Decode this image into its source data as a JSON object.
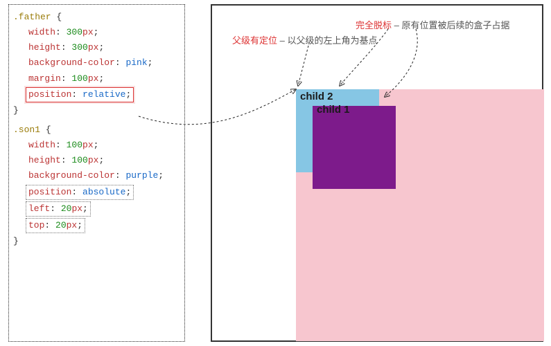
{
  "code": {
    "father": {
      "selector": ".father",
      "open": " {",
      "close": "}",
      "rules": {
        "width": {
          "prop": "width",
          "value": "300",
          "unit": "px",
          "term": ";"
        },
        "height": {
          "prop": "height",
          "value": "300",
          "unit": "px",
          "term": ";"
        },
        "background_color": {
          "prop": "background-color",
          "value": "pink",
          "term": ";"
        },
        "margin": {
          "prop": "margin",
          "value": "100",
          "unit": "px",
          "term": ";"
        },
        "position": {
          "prop": "position",
          "value": "relative",
          "term": ";"
        }
      }
    },
    "son1": {
      "selector": ".son1",
      "open": " {",
      "close": "}",
      "rules": {
        "width": {
          "prop": "width",
          "value": "100",
          "unit": "px",
          "term": ";"
        },
        "height": {
          "prop": "height",
          "value": "100",
          "unit": "px",
          "term": ";"
        },
        "background_color": {
          "prop": "background-color",
          "value": "purple",
          "term": ";"
        },
        "position": {
          "prop": "position",
          "value": "absolute",
          "term": ";"
        },
        "left": {
          "prop": "left",
          "value": "20",
          "unit": "px",
          "term": ";"
        },
        "top": {
          "prop": "top",
          "value": "20",
          "unit": "px",
          "term": ";"
        }
      }
    }
  },
  "labels": {
    "child1": "child 1",
    "child2": "child 2"
  },
  "annotations": {
    "anchor": {
      "red": "父级有定位",
      "grey": " – 以父级的左上角为基点"
    },
    "flow": {
      "red": "完全脱标",
      "grey": " – 原有位置被后续的盒子占据"
    }
  },
  "colors": {
    "pink": "#f7c6cf",
    "skyblue": "#86c6e4",
    "purple": "#7d1b8b",
    "accent_red": "#d33"
  }
}
